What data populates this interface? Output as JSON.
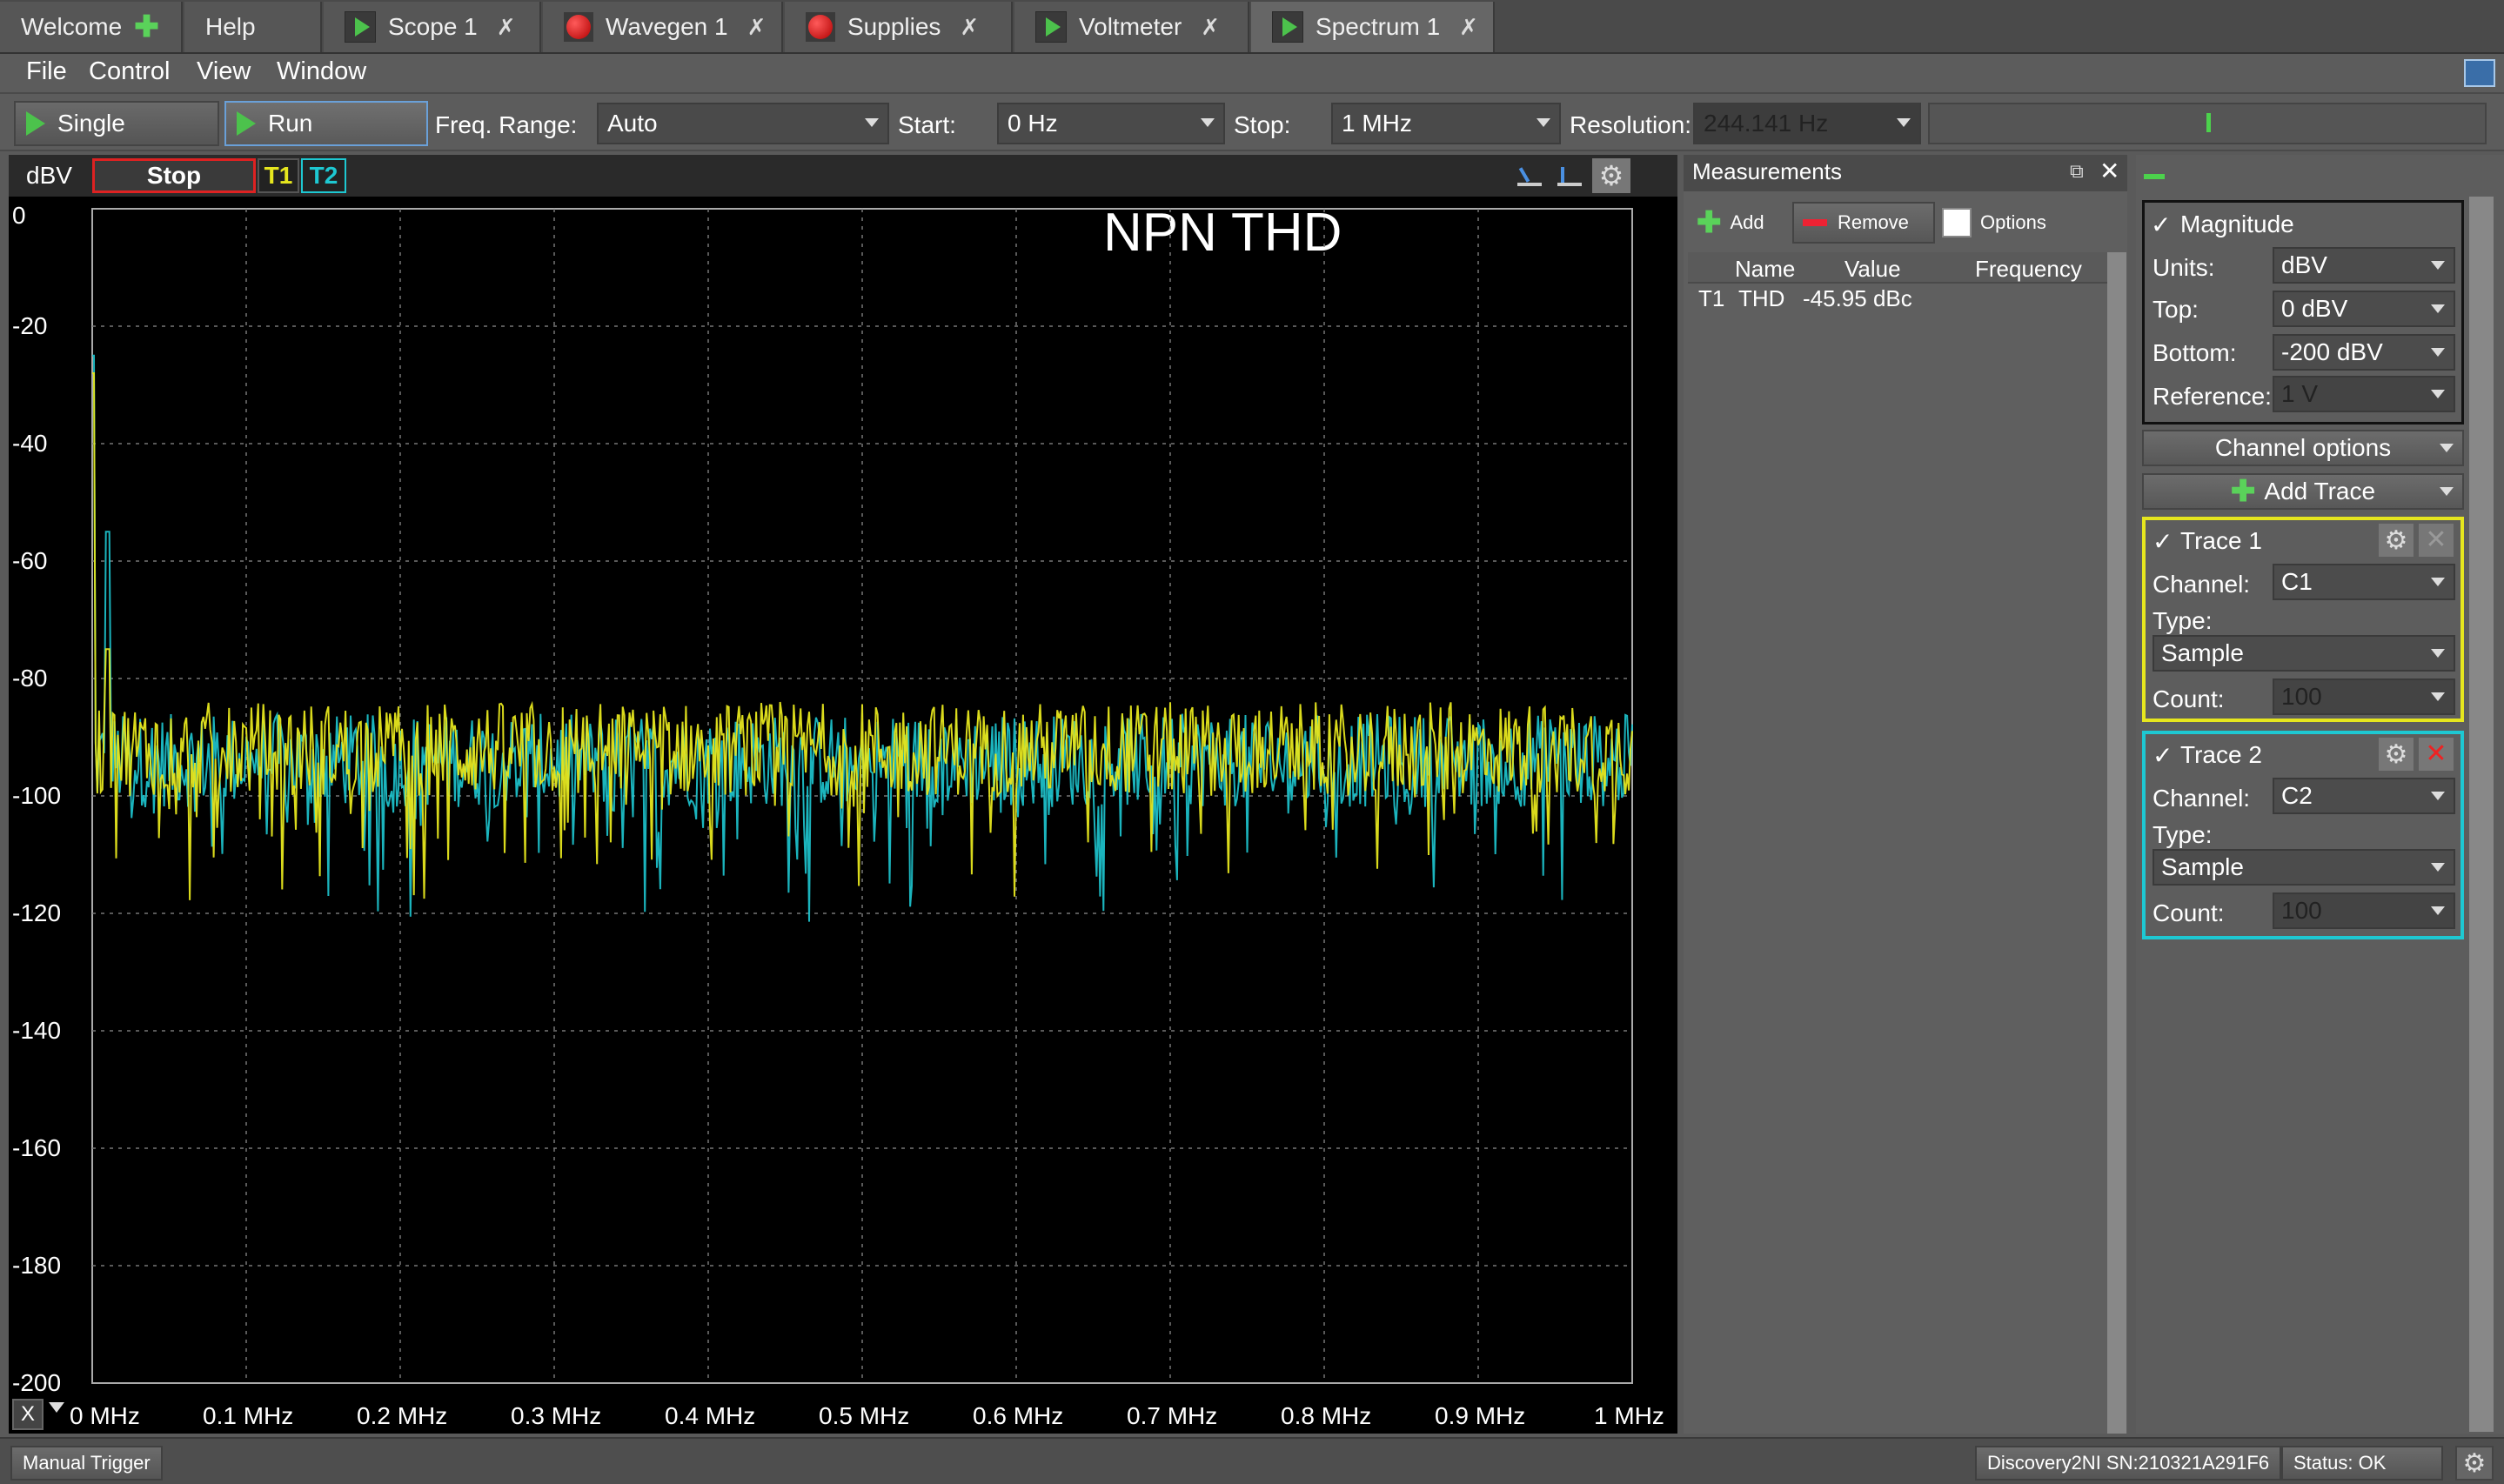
{
  "tabs": [
    {
      "label": "Welcome",
      "icon": "plus-icon",
      "closable": false
    },
    {
      "label": "Help",
      "icon": "",
      "closable": false
    },
    {
      "label": "Scope 1",
      "icon": "play-icon",
      "closable": true
    },
    {
      "label": "Wavegen 1",
      "icon": "record-icon",
      "closable": true
    },
    {
      "label": "Supplies",
      "icon": "record-icon",
      "closable": true
    },
    {
      "label": "Voltmeter",
      "icon": "play-icon",
      "closable": true
    },
    {
      "label": "Spectrum 1",
      "icon": "play-icon",
      "closable": true,
      "active": true
    }
  ],
  "close_glyph": "✗",
  "menu": [
    "File",
    "Control",
    "View",
    "Window"
  ],
  "toolbar": {
    "single_label": "Single",
    "run_label": "Run",
    "freq_range_label": "Freq. Range:",
    "freq_range_value": "Auto",
    "start_label": "Start:",
    "start_value": "0 Hz",
    "stop_label": "Stop:",
    "stop_value": "1 MHz",
    "resolution_label": "Resolution:",
    "resolution_value": "244.141 Hz"
  },
  "plot": {
    "unit_label": "dBV",
    "stop_button": "Stop",
    "trace1_tag": "T1",
    "trace2_tag": "T2",
    "title": "NPN THD",
    "x_button": "X",
    "trace1_color": "#e6e61e",
    "trace2_color": "#1ec8d2"
  },
  "chart_data": {
    "type": "line",
    "title": "NPN THD",
    "xlabel": "",
    "ylabel": "dBV",
    "ylim": [
      -200,
      0
    ],
    "xlim": [
      0,
      1
    ],
    "y_ticks": [
      "0",
      "-20",
      "-40",
      "-60",
      "-80",
      "-100",
      "-120",
      "-140",
      "-160",
      "-180",
      "-200"
    ],
    "x_ticks": [
      "0 MHz",
      "0.1 MHz",
      "0.2 MHz",
      "0.3 MHz",
      "0.4 MHz",
      "0.5 MHz",
      "0.6 MHz",
      "0.7 MHz",
      "0.8 MHz",
      "0.9 MHz",
      "1 MHz"
    ],
    "grid": true,
    "series": [
      {
        "name": "T1",
        "color": "#e6e61e",
        "noise_floor_dbv": -92,
        "peaks": [
          {
            "x": 0.0,
            "y": -28
          },
          {
            "x": 0.01,
            "y": -75
          }
        ]
      },
      {
        "name": "T2",
        "color": "#1ec8d2",
        "noise_floor_dbv": -94,
        "peaks": [
          {
            "x": 0.0,
            "y": -25
          },
          {
            "x": 0.01,
            "y": -55
          }
        ]
      }
    ]
  },
  "measurements": {
    "title": "Measurements",
    "add_label": "Add",
    "remove_label": "Remove",
    "options_label": "Options",
    "columns": [
      "Name",
      "Value",
      "Frequency"
    ],
    "rows": [
      {
        "trace": "T1",
        "name": "THD",
        "value": "-45.95 dBc",
        "frequency": ""
      }
    ]
  },
  "right_panel": {
    "magnitude_label": "Magnitude",
    "units_label": "Units:",
    "units_value": "dBV",
    "top_label": "Top:",
    "top_value": "0 dBV",
    "bottom_label": "Bottom:",
    "bottom_value": "-200 dBV",
    "reference_label": "Reference:",
    "reference_value": "1 V",
    "channel_options_label": "Channel options",
    "add_trace_label": "Add Trace",
    "traces": [
      {
        "title": "Trace 1",
        "channel_label": "Channel:",
        "channel_value": "C1",
        "type_label": "Type:",
        "type_value": "Sample",
        "count_label": "Count:",
        "count_value": "100",
        "border_color": "#e6e61e"
      },
      {
        "title": "Trace 2",
        "channel_label": "Channel:",
        "channel_value": "C2",
        "type_label": "Type:",
        "type_value": "Sample",
        "count_label": "Count:",
        "count_value": "100",
        "border_color": "#1ec8d2"
      }
    ]
  },
  "status": {
    "manual_trigger": "Manual Trigger",
    "device": "Discovery2NI SN:210321A291F6",
    "status_text": "Status: OK"
  }
}
